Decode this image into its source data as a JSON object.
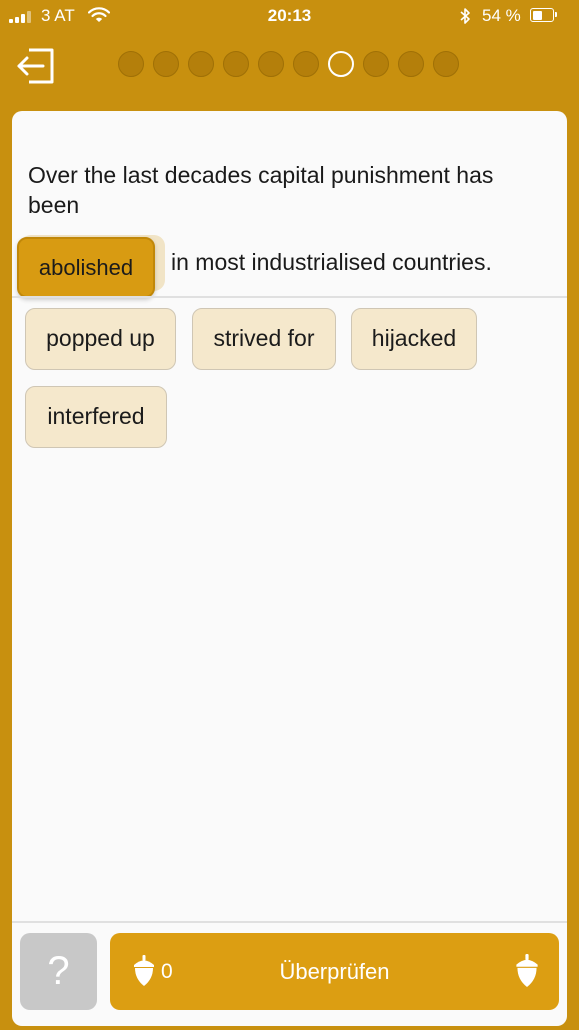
{
  "status_bar": {
    "carrier": "3 AT",
    "time": "20:13",
    "battery_percent": "54 %",
    "battery_level": 0.54,
    "signal_bars_filled": 3,
    "signal_bars_total": 4
  },
  "header": {
    "exit_icon": "exit-arrow-icon",
    "progress": {
      "total_steps": 10,
      "current_step": 7
    }
  },
  "exercise": {
    "question_lead": "Over the last decades capital punishment has been",
    "selected_answer": "abolished",
    "question_tail": "in most industrialised countries.",
    "options": [
      "popped up",
      "strived for",
      "hijacked",
      "interfered"
    ]
  },
  "footer": {
    "help_label": "?",
    "acorn_count": "0",
    "check_label": "Überprüfen"
  },
  "colors": {
    "brand": "#C8900F",
    "accent": "#DC9E12",
    "chip": "#F5E8CC",
    "help_gray": "#C8C8C8"
  }
}
